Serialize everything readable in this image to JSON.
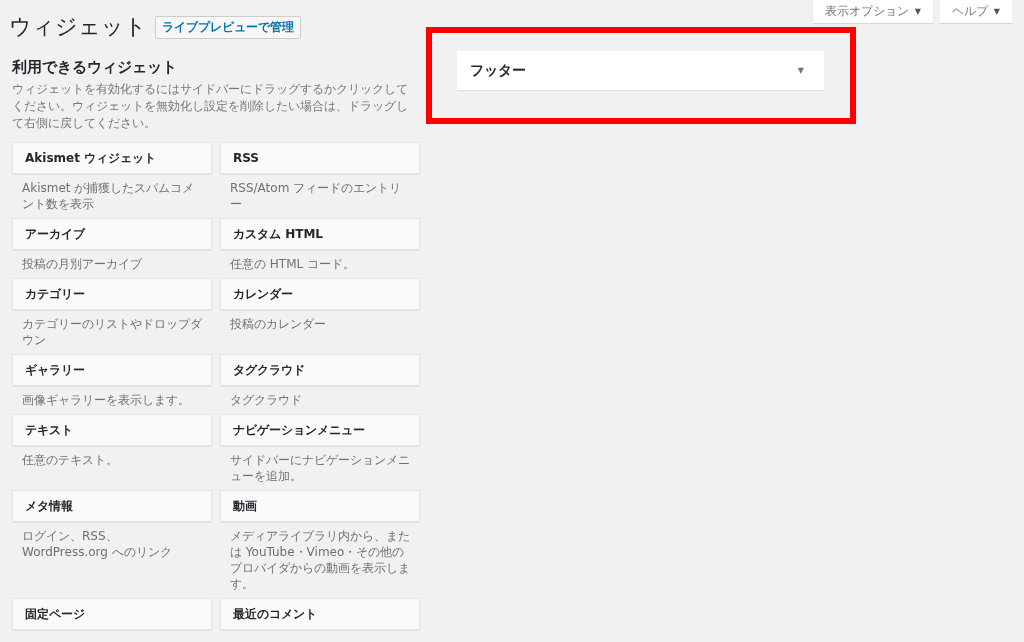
{
  "page_title": "ウィジェット",
  "live_preview_button": "ライブプレビューで管理",
  "screen_options": [
    {
      "label": "表示オプション",
      "icon": "▼"
    },
    {
      "label": "ヘルプ",
      "icon": "▼"
    }
  ],
  "available_widgets": {
    "heading": "利用できるウィジェット",
    "description": "ウィジェットを有効化するにはサイドバーにドラッグするかクリックしてください。ウィジェットを無効化し設定を削除したい場合は、ドラッグして右側に戻してください。",
    "widgets": [
      {
        "title": "Akismet ウィジェット",
        "description": "Akismet が捕獲したスパムコメント数を表示"
      },
      {
        "title": "RSS",
        "description": "RSS/Atom フィードのエントリー"
      },
      {
        "title": "アーカイブ",
        "description": "投稿の月別アーカイブ"
      },
      {
        "title": "カスタム HTML",
        "description": "任意の HTML コード。"
      },
      {
        "title": "カテゴリー",
        "description": "カテゴリーのリストやドロップダウン"
      },
      {
        "title": "カレンダー",
        "description": "投稿のカレンダー"
      },
      {
        "title": "ギャラリー",
        "description": "画像ギャラリーを表示します。"
      },
      {
        "title": "タグクラウド",
        "description": "タグクラウド"
      },
      {
        "title": "テキスト",
        "description": "任意のテキスト。"
      },
      {
        "title": "ナビゲーションメニュー",
        "description": "サイドバーにナビゲーションメニューを追加。"
      },
      {
        "title": "メタ情報",
        "description": "ログイン、RSS、WordPress.org へのリンク"
      },
      {
        "title": "動画",
        "description": "メディアライブラリ内から、または YouTube・Vimeo・その他のプロバイダからの動画を表示します。"
      },
      {
        "title": "固定ページ"
      },
      {
        "title": "最近のコメント"
      }
    ]
  },
  "sidebars": [
    {
      "title": "フッター",
      "toggle": "▼",
      "expanded": false,
      "highlighted": true
    }
  ]
}
